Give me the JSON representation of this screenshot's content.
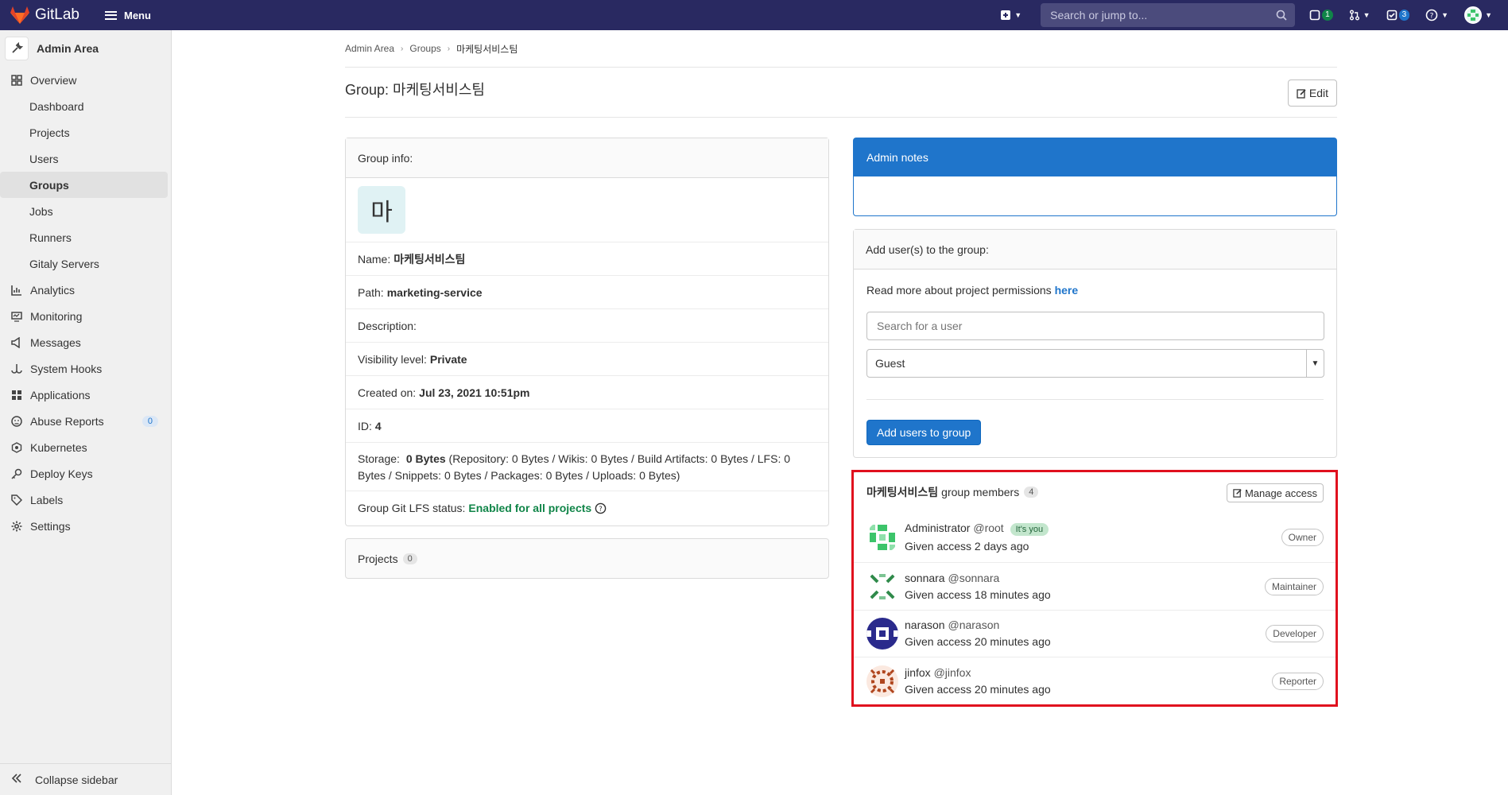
{
  "topbar": {
    "brand": "GitLab",
    "menu_label": "Menu",
    "search_placeholder": "Search or jump to...",
    "issues_count": "1",
    "todos_count": "3",
    "brand_color": "#292961"
  },
  "sidebar": {
    "context_title": "Admin Area",
    "items": [
      {
        "label": "Overview",
        "icon": "overview-icon"
      },
      {
        "label": "Dashboard"
      },
      {
        "label": "Projects"
      },
      {
        "label": "Users"
      },
      {
        "label": "Groups",
        "active": true
      },
      {
        "label": "Jobs"
      },
      {
        "label": "Runners"
      },
      {
        "label": "Gitaly Servers"
      },
      {
        "label": "Analytics",
        "icon": "analytics-icon"
      },
      {
        "label": "Monitoring",
        "icon": "monitoring-icon"
      },
      {
        "label": "Messages",
        "icon": "messages-icon"
      },
      {
        "label": "System Hooks",
        "icon": "hooks-icon"
      },
      {
        "label": "Applications",
        "icon": "applications-icon"
      },
      {
        "label": "Abuse Reports",
        "icon": "abuse-icon",
        "count": "0"
      },
      {
        "label": "Kubernetes",
        "icon": "kubernetes-icon"
      },
      {
        "label": "Deploy Keys",
        "icon": "key-icon"
      },
      {
        "label": "Labels",
        "icon": "label-icon"
      },
      {
        "label": "Settings",
        "icon": "settings-icon"
      }
    ],
    "collapse_label": "Collapse sidebar"
  },
  "breadcrumb": [
    "Admin Area",
    "Groups",
    "마케팅서비스팀"
  ],
  "page": {
    "title": "Group: 마케팅서비스팀",
    "edit_label": "Edit"
  },
  "group_info": {
    "header": "Group info:",
    "avatar_letter": "마",
    "name_label": "Name:",
    "name_value": "마케팅서비스팀",
    "path_label": "Path:",
    "path_value": "marketing-service",
    "description_label": "Description:",
    "visibility_label": "Visibility level:",
    "visibility_value": "Private",
    "created_label": "Created on:",
    "created_value": "Jul 23, 2021 10:51pm",
    "id_label": "ID:",
    "id_value": "4",
    "storage_label": "Storage:",
    "storage_value": "0 Bytes",
    "storage_detail": "(Repository: 0 Bytes / Wikis: 0 Bytes / Build Artifacts: 0 Bytes / LFS: 0 Bytes / Snippets: 0 Bytes / Packages: 0 Bytes / Uploads: 0 Bytes)",
    "lfs_label": "Group Git LFS status:",
    "lfs_value": "Enabled for all projects"
  },
  "projects_card": {
    "label": "Projects",
    "count": "0"
  },
  "admin_notes": {
    "header": "Admin notes"
  },
  "add_users": {
    "header": "Add user(s) to the group:",
    "permissions_text": "Read more about project permissions",
    "permissions_link": "here",
    "search_placeholder": "Search for a user",
    "role_value": "Guest",
    "submit_label": "Add users to group"
  },
  "members": {
    "group_name": "마케팅서비스팀",
    "title_suffix": "group members",
    "count": "4",
    "manage_label": "Manage access",
    "list": [
      {
        "name": "Administrator",
        "username": "@root",
        "badge": "It's you",
        "access": "Given access 2 days ago",
        "role": "Owner",
        "avatar_color": "#3cc46a"
      },
      {
        "name": "sonnara",
        "username": "@sonnara",
        "badge": "",
        "access": "Given access 18 minutes ago",
        "role": "Maintainer",
        "avatar_color": "#2f8a4a"
      },
      {
        "name": "narason",
        "username": "@narason",
        "badge": "",
        "access": "Given access 20 minutes ago",
        "role": "Developer",
        "avatar_color": "#2a2a8c"
      },
      {
        "name": "jinfox",
        "username": "@jinfox",
        "badge": "",
        "access": "Given access 20 minutes ago",
        "role": "Reporter",
        "avatar_color": "#b0461e"
      }
    ]
  }
}
